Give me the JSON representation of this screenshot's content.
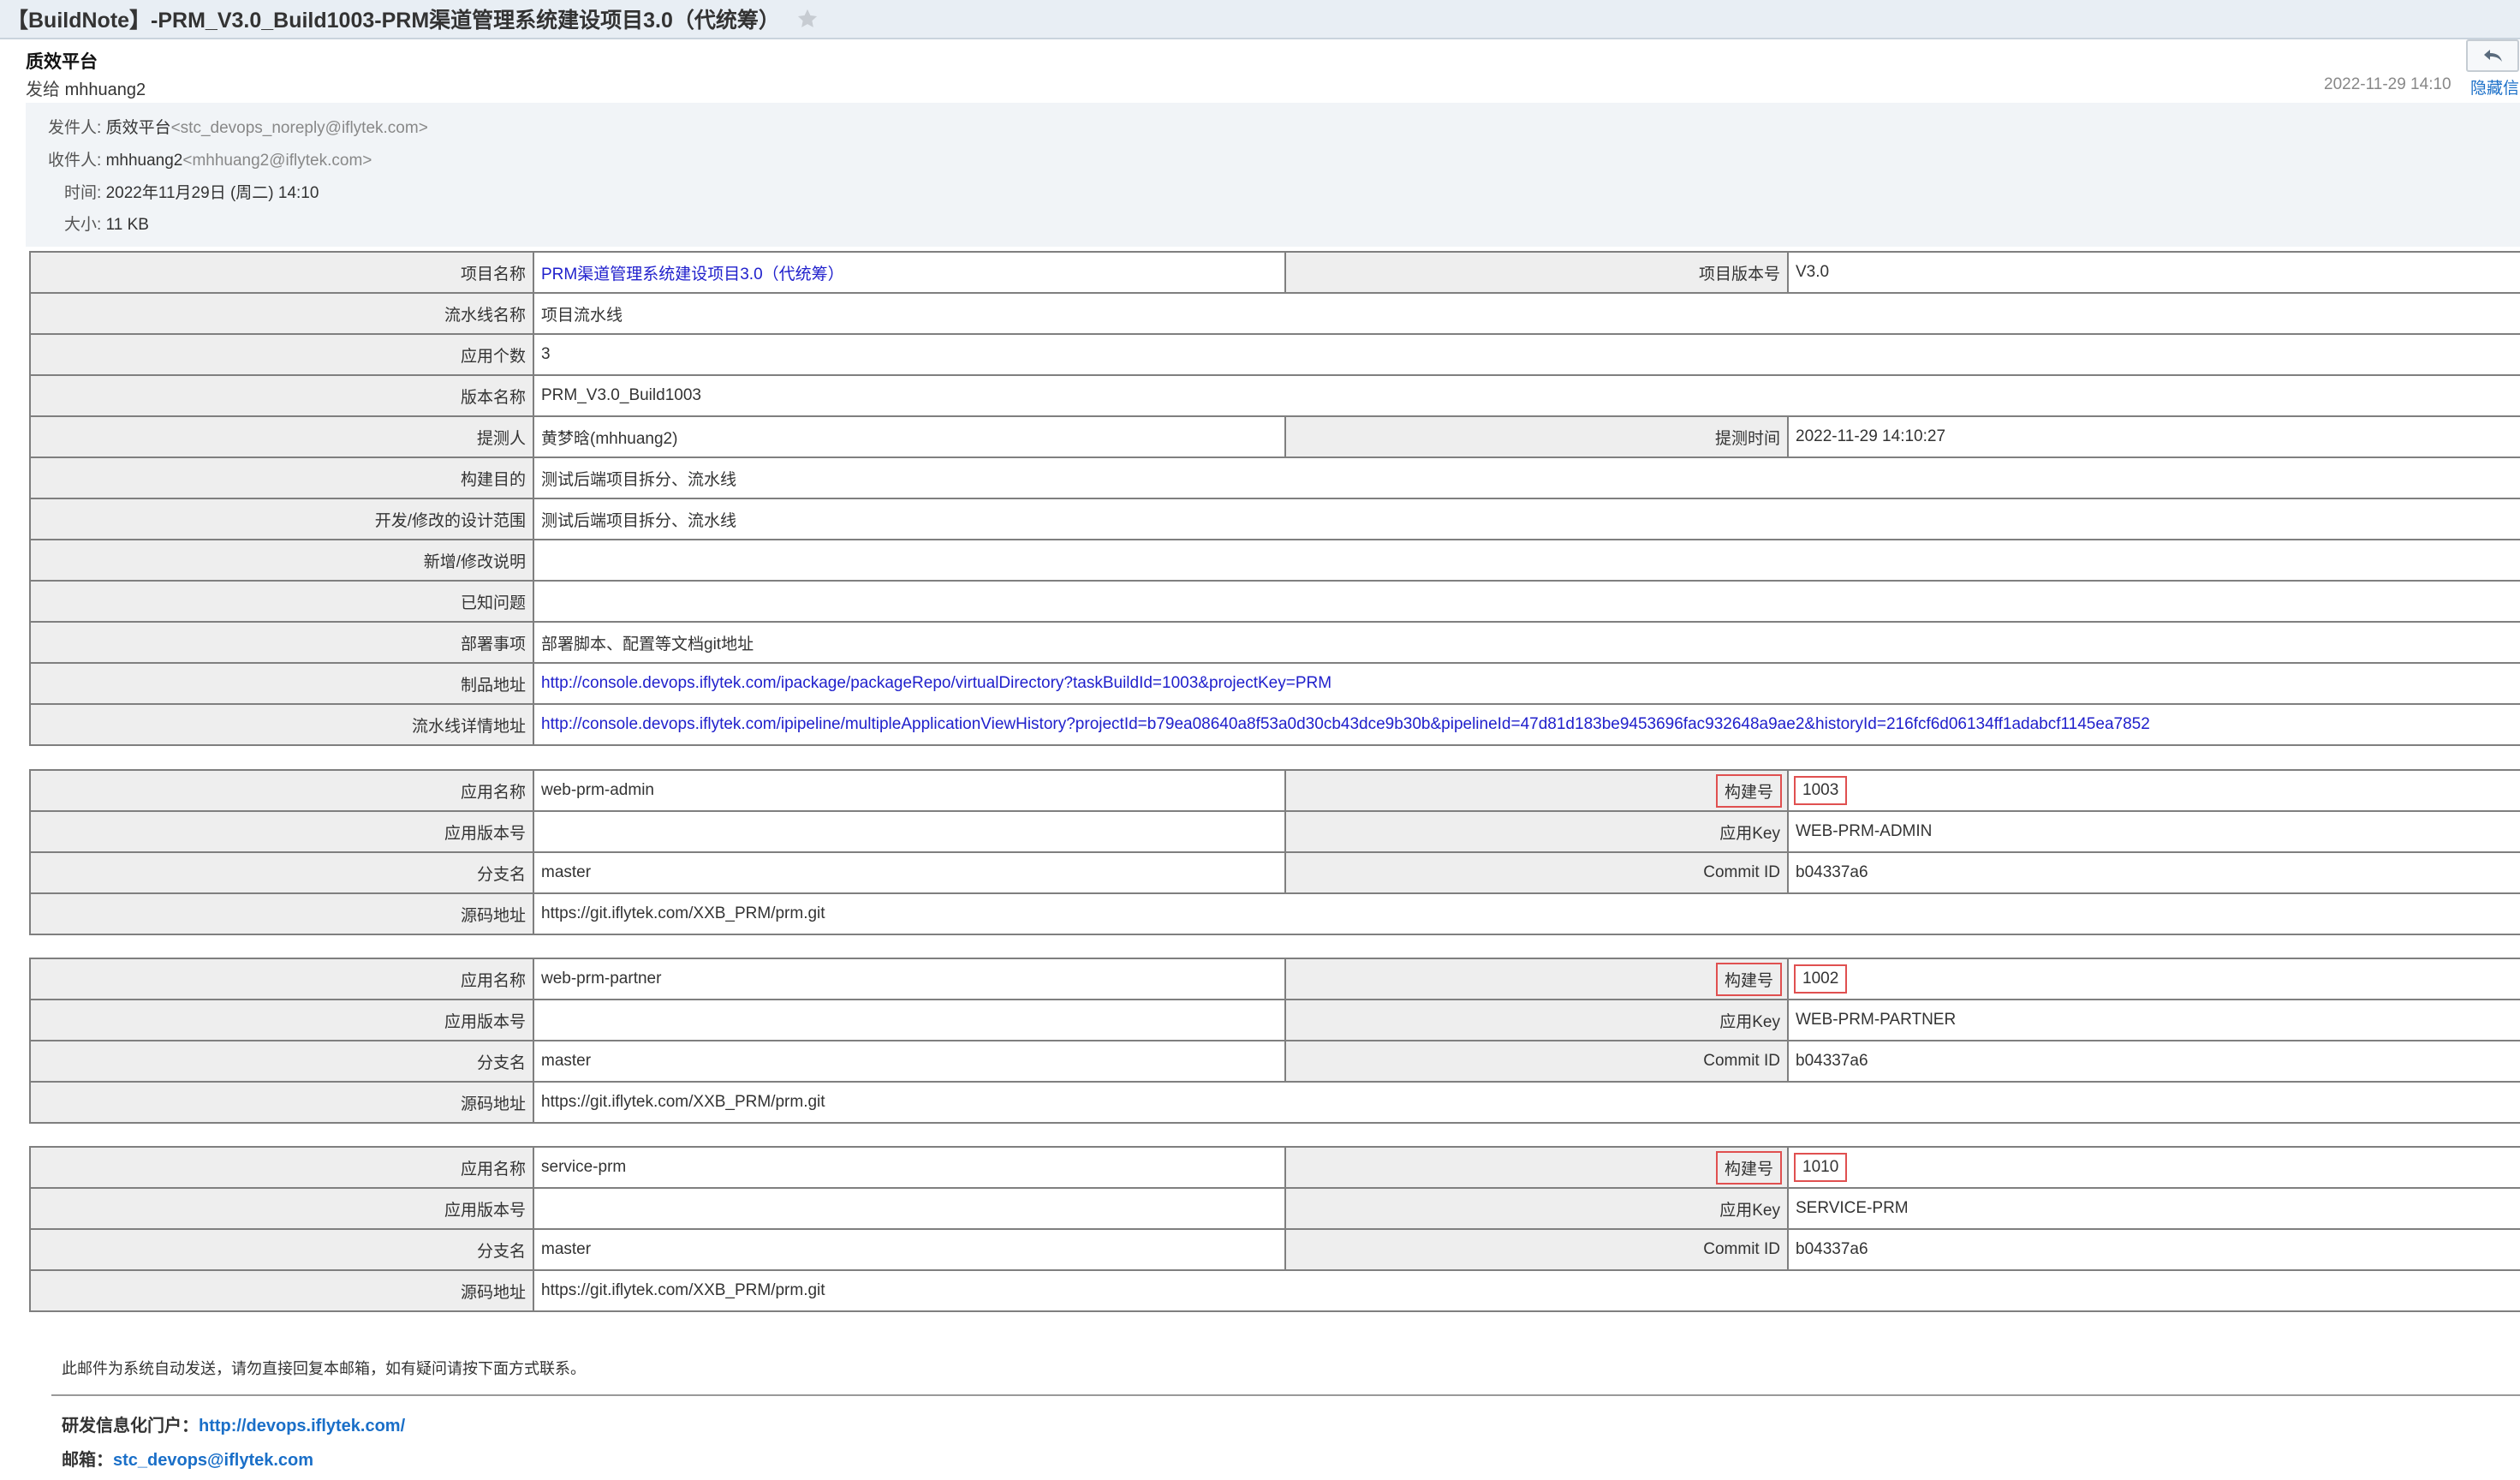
{
  "subject": "【BuildNote】-PRM_V3.0_Build1003-PRM渠道管理系统建设项目3.0（代统筹）",
  "header": {
    "sender_name": "质效平台",
    "sent_to_prefix": "发给",
    "sent_to": "mhhuang2",
    "date": "2022-11-29 14:10",
    "hide_label": "隐藏信"
  },
  "meta": {
    "from_label": "发件人:",
    "from_name": "质效平台",
    "from_addr": "<stc_devops_noreply@iflytek.com>",
    "to_label": "收件人:",
    "to_name": "mhhuang2",
    "to_addr": "<mhhuang2@iflytek.com>",
    "time_label": "时间:",
    "time_value": "2022年11月29日 (周二) 14:10",
    "size_label": "大小:",
    "size_value": "11 KB"
  },
  "project": {
    "name_label": "项目名称",
    "name": "PRM渠道管理系统建设项目3.0（代统筹）",
    "version_label": "项目版本号",
    "version": "V3.0",
    "pipeline_label": "流水线名称",
    "pipeline": "项目流水线",
    "app_count_label": "应用个数",
    "app_count": "3",
    "build_name_label": "版本名称",
    "build_name": "PRM_V3.0_Build1003",
    "submitter_label": "提测人",
    "submitter": "黄梦晗(mhhuang2)",
    "submit_time_label": "提测时间",
    "submit_time": "2022-11-29 14:10:27",
    "purpose_label": "构建目的",
    "purpose": "测试后端项目拆分、流水线",
    "scope_label": "开发/修改的设计范围",
    "scope": "测试后端项目拆分、流水线",
    "changes_label": "新增/修改说明",
    "changes": "",
    "issues_label": "已知问题",
    "issues": "",
    "deploy_label": "部署事项",
    "deploy": "部署脚本、配置等文档git地址",
    "artifact_label": "制品地址",
    "artifact_url": "http://console.devops.iflytek.com/ipackage/packageRepo/virtualDirectory?taskBuildId=1003&projectKey=PRM",
    "pipeline_url_label": "流水线详情地址",
    "pipeline_url": "http://console.devops.iflytek.com/ipipeline/multipleApplicationViewHistory?projectId=b79ea08640a8f53a0d30cb43dce9b30b&pipelineId=47d81d183be9453696fac932648a9ae2&historyId=216fcf6d06134ff1adabcf1145ea7852"
  },
  "app_labels": {
    "app_name": "应用名称",
    "build_no": "构建号",
    "app_version": "应用版本号",
    "app_key": "应用Key",
    "branch": "分支名",
    "commit": "Commit ID",
    "repo": "源码地址"
  },
  "apps": [
    {
      "name": "web-prm-admin",
      "build_no": "1003",
      "version": "",
      "key": "WEB-PRM-ADMIN",
      "branch": "master",
      "commit": "b04337a6",
      "repo": "https://git.iflytek.com/XXB_PRM/prm.git"
    },
    {
      "name": "web-prm-partner",
      "build_no": "1002",
      "version": "",
      "key": "WEB-PRM-PARTNER",
      "branch": "master",
      "commit": "b04337a6",
      "repo": "https://git.iflytek.com/XXB_PRM/prm.git"
    },
    {
      "name": "service-prm",
      "build_no": "1010",
      "version": "",
      "key": "SERVICE-PRM",
      "branch": "master",
      "commit": "b04337a6",
      "repo": "https://git.iflytek.com/XXB_PRM/prm.git"
    }
  ],
  "footer": {
    "note": "此邮件为系统自动发送，请勿直接回复本邮箱，如有疑问请按下面方式联系。",
    "portal_label": "研发信息化门户：",
    "portal_url": "http://devops.iflytek.com/",
    "mail_label": "邮箱：",
    "mail_addr": "stc_devops@iflytek.com"
  },
  "colors": {
    "link": "#2020cc",
    "highlight": "#e05050",
    "label_bg": "#eeeeee"
  }
}
